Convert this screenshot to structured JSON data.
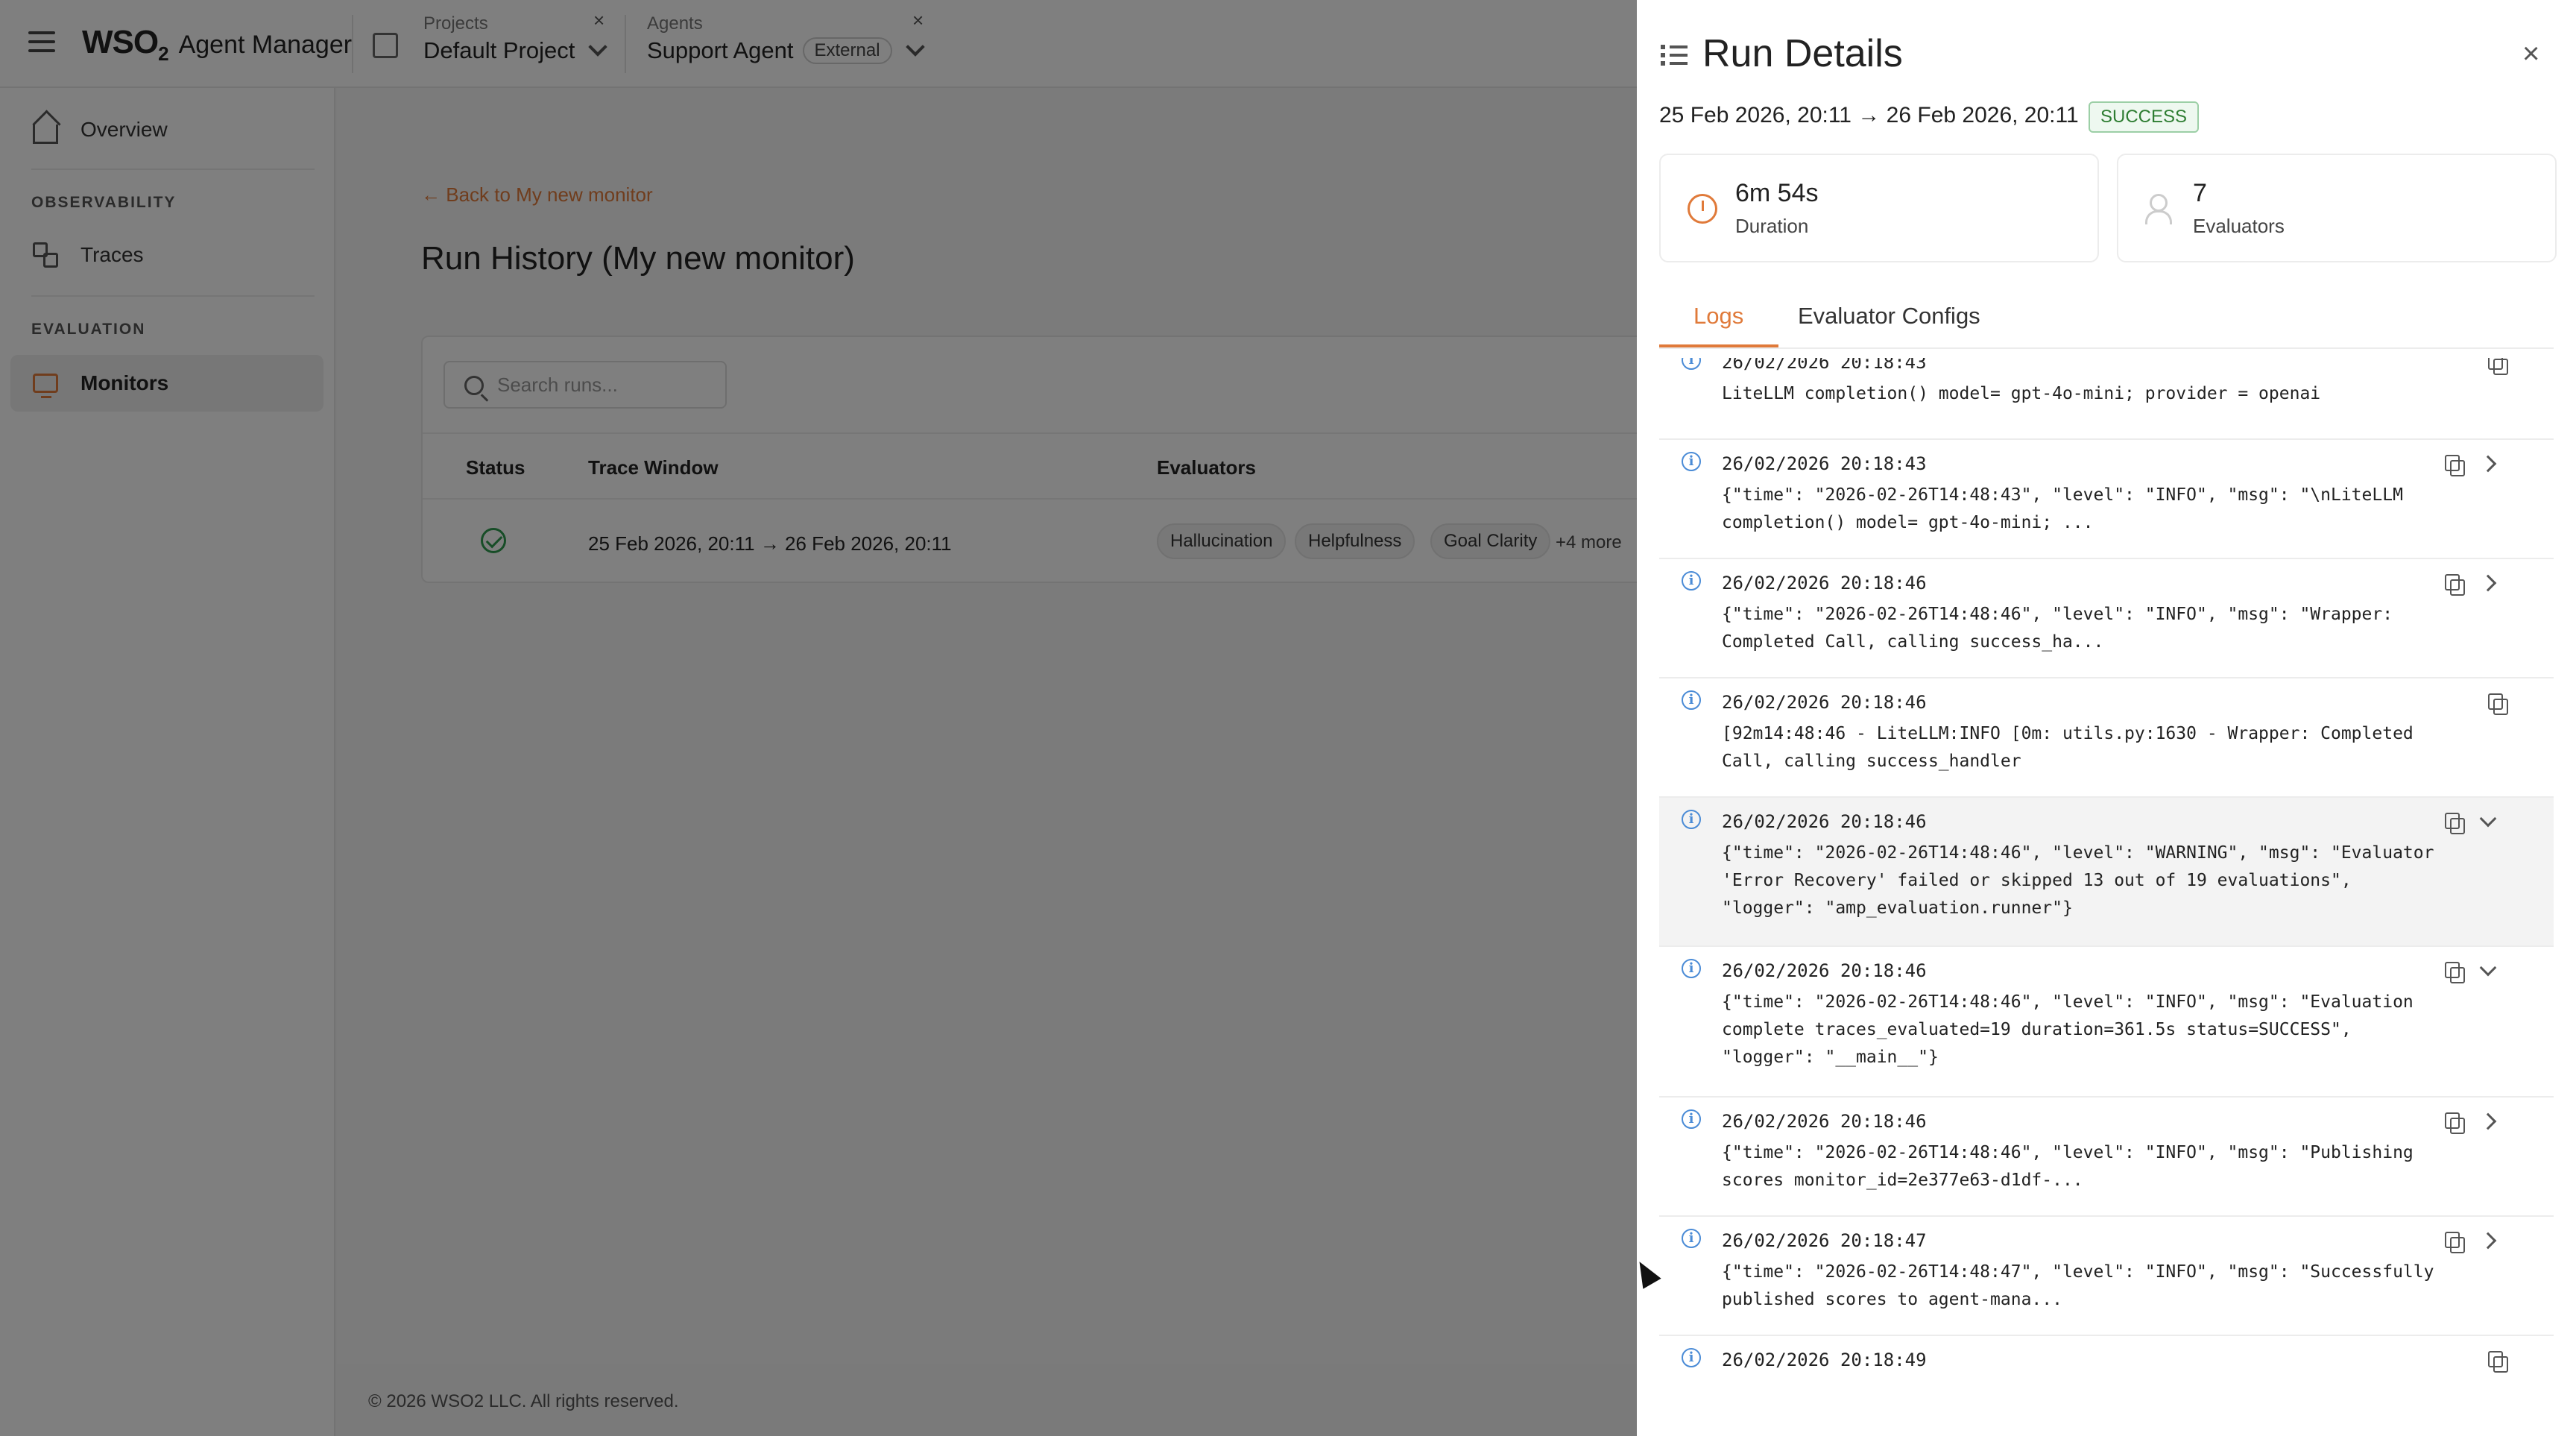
{
  "topbar": {
    "logo_brand": "WSO",
    "logo_sub": "2",
    "logo_product": "Agent Manager",
    "project_caption": "Projects",
    "project_value": "Default Project",
    "agent_caption": "Agents",
    "agent_value": "Support Agent",
    "agent_tag": "External",
    "close_glyph": "×"
  },
  "sidebar": {
    "overview": "Overview",
    "section_observability": "OBSERVABILITY",
    "traces": "Traces",
    "section_evaluation": "EVALUATION",
    "monitors": "Monitors"
  },
  "main": {
    "back_link": "← Back to My new monitor",
    "title": "Run History (My new monitor)",
    "search_placeholder": "Search runs...",
    "columns": {
      "status": "Status",
      "trace_window": "Trace Window",
      "evaluators": "Evaluators"
    },
    "row": {
      "trace_window": "25 Feb 2026, 20:11 → 26 Feb 2026, 20:11",
      "chips": [
        "Hallucination",
        "Helpfulness",
        "Goal Clarity"
      ],
      "more": "+4 more"
    }
  },
  "footer": "© 2026 WSO2 LLC. All rights reserved.",
  "drawer": {
    "title": "Run Details",
    "close": "×",
    "range": "25 Feb 2026, 20:11 → 26 Feb 2026, 20:11",
    "status": "SUCCESS",
    "duration_value": "6m 54s",
    "duration_label": "Duration",
    "evaluators_value": "7",
    "evaluators_label": "Evaluators",
    "tabs": [
      "Logs",
      "Evaluator Configs"
    ],
    "active_tab": "Logs",
    "logs": [
      {
        "ts": "26/02/2026 20:18:43",
        "msg": "LiteLLM completion() model= gpt-4o-mini; provider = openai",
        "expand": "none"
      },
      {
        "ts": "26/02/2026 20:18:43",
        "msg": "{\"time\": \"2026-02-26T14:48:43\", \"level\": \"INFO\", \"msg\": \"\\nLiteLLM completion() model= gpt-4o-mini; ...",
        "expand": "right"
      },
      {
        "ts": "26/02/2026 20:18:46",
        "msg": "{\"time\": \"2026-02-26T14:48:46\", \"level\": \"INFO\", \"msg\": \"Wrapper: Completed Call, calling success_ha...",
        "expand": "right"
      },
      {
        "ts": "26/02/2026 20:18:46",
        "msg": "[92m14:48:46 - LiteLLM:INFO [0m: utils.py:1630 - Wrapper: Completed Call, calling success_handler",
        "expand": "none"
      },
      {
        "ts": "26/02/2026 20:18:46",
        "msg": "{\"time\": \"2026-02-26T14:48:46\", \"level\": \"WARNING\", \"msg\": \"Evaluator 'Error Recovery' failed or skipped 13 out of 19 evaluations\", \"logger\": \"amp_evaluation.runner\"}",
        "expand": "down"
      },
      {
        "ts": "26/02/2026 20:18:46",
        "msg": "{\"time\": \"2026-02-26T14:48:46\", \"level\": \"INFO\", \"msg\": \"Evaluation complete traces_evaluated=19 duration=361.5s status=SUCCESS\", \"logger\": \"__main__\"}",
        "expand": "down"
      },
      {
        "ts": "26/02/2026 20:18:46",
        "msg": "{\"time\": \"2026-02-26T14:48:46\", \"level\": \"INFO\", \"msg\": \"Publishing scores monitor_id=2e377e63-d1df-...",
        "expand": "right"
      },
      {
        "ts": "26/02/2026 20:18:47",
        "msg": "{\"time\": \"2026-02-26T14:48:47\", \"level\": \"INFO\", \"msg\": \"Successfully published scores to agent-mana...",
        "expand": "right"
      },
      {
        "ts": "26/02/2026 20:18:49",
        "msg": "",
        "expand": "none"
      }
    ]
  }
}
